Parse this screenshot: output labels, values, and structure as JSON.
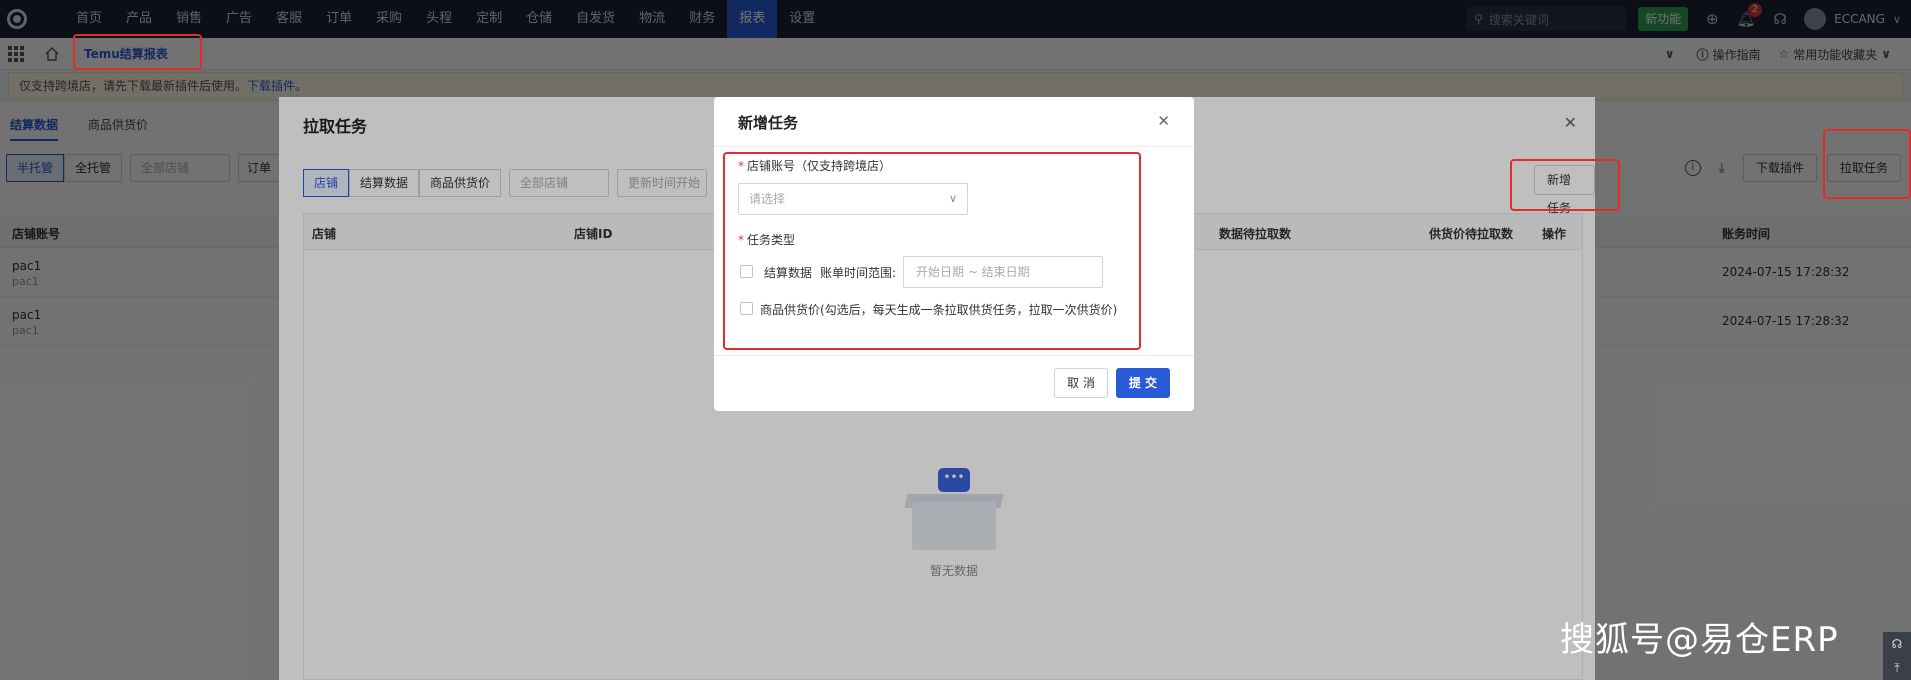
{
  "topnav": {
    "menu": [
      "首页",
      "产品",
      "销售",
      "广告",
      "客服",
      "订单",
      "采购",
      "头程",
      "定制",
      "仓储",
      "自发货",
      "物流",
      "财务",
      "报表",
      "设置"
    ],
    "active_index": 13,
    "search_placeholder": "搜索关键词",
    "new_feature": "新功能",
    "notification_count": "2",
    "username": "ECCANG"
  },
  "tabbar": {
    "page_tab": "Temu结算报表",
    "guide": "操作指南",
    "favorites": "常用功能收藏夹"
  },
  "notice": {
    "text": "仅支持跨境店，请先下载最新插件后使用。",
    "link": "下载插件。"
  },
  "bg_page": {
    "subtabs": [
      "结算数据",
      "商品供货价"
    ],
    "seg_buttons": [
      "半托管",
      "全托管"
    ],
    "store_select": "全部店铺",
    "order_select": "订单",
    "col_account": "店铺账号",
    "col_time": "账务时间",
    "download_plugin": "下载插件",
    "pull_task": "拉取任务",
    "rows": [
      {
        "account": "pac1",
        "sub": "pac1",
        "time": "2024-07-15 17:28:32"
      },
      {
        "account": "pac1",
        "sub": "pac1",
        "time": "2024-07-15 17:28:32"
      }
    ]
  },
  "pull_dialog": {
    "title": "拉取任务",
    "seg_buttons": [
      "店铺",
      "结算数据",
      "商品供货价"
    ],
    "store_select": "全部店铺",
    "update_time": "更新时间开始",
    "new_task": "新增任务",
    "columns": [
      "店铺",
      "店铺ID",
      "数据待拉取数",
      "供货价待拉取数",
      "操作"
    ],
    "empty": "暂无数据"
  },
  "new_dialog": {
    "title": "新增任务",
    "store_label": "店铺账号（仅支持跨境店）",
    "store_placeholder": "请选择",
    "type_label": "任务类型",
    "opt1": "结算数据",
    "range_label": "账单时间范围:",
    "date_placeholder": "开始日期 ~ 结束日期",
    "opt2": "商品供货价(勾选后，每天生成一条拉取供货任务，拉取一次供货价)",
    "cancel": "取 消",
    "submit": "提 交"
  },
  "watermark": "搜狐号@易仓ERP"
}
